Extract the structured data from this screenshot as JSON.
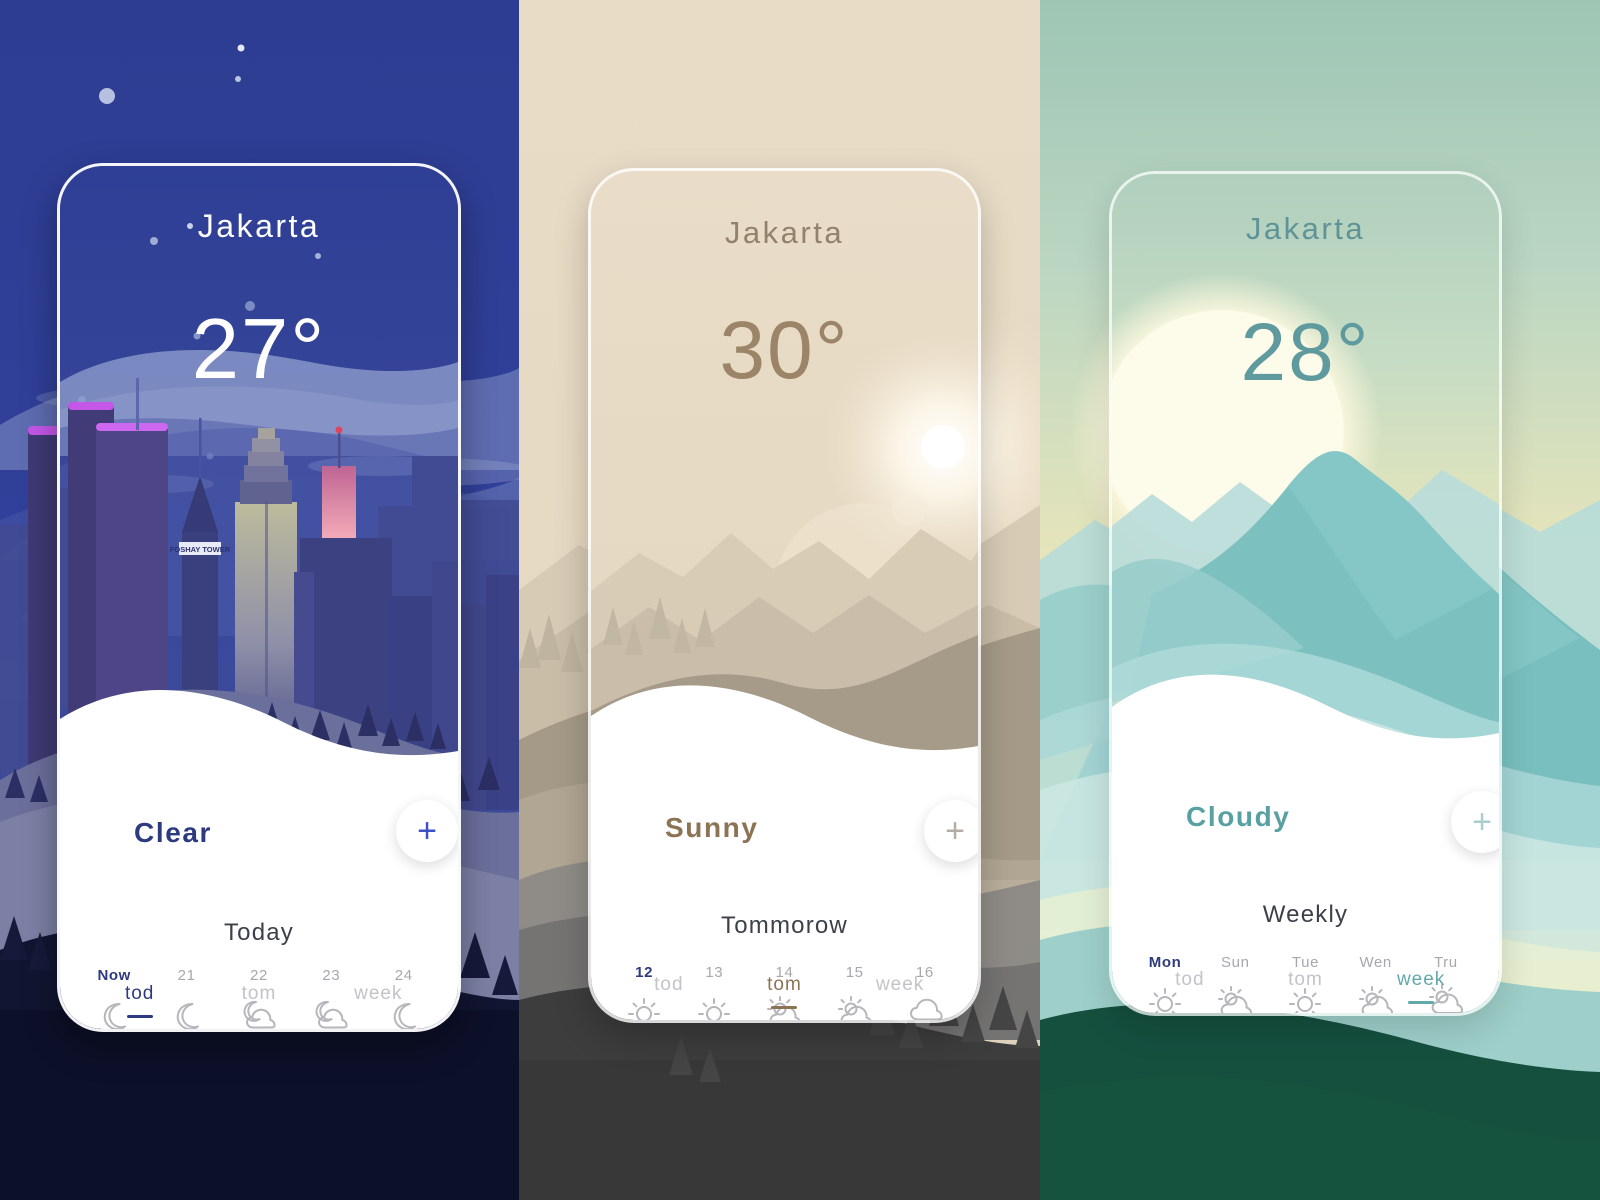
{
  "panels": [
    {
      "id": "night",
      "theme": "night-city",
      "accent": "#2e3a80",
      "city": "Jakarta",
      "temperature": "27°",
      "condition": "Clear",
      "add_label": "+",
      "day_title": "Today",
      "forecast": [
        {
          "label": "Now",
          "icon": "moon-icon",
          "active": true
        },
        {
          "label": "21",
          "icon": "moon-icon",
          "active": false
        },
        {
          "label": "22",
          "icon": "moon-cloud-icon",
          "active": false
        },
        {
          "label": "23",
          "icon": "moon-cloud-icon",
          "active": false
        },
        {
          "label": "24",
          "icon": "moon-icon",
          "active": false
        }
      ],
      "tabs": [
        {
          "label": "tod",
          "active": true
        },
        {
          "label": "tom",
          "active": false
        },
        {
          "label": "week",
          "active": false
        }
      ]
    },
    {
      "id": "sunrise",
      "theme": "sunrise-mountain",
      "accent": "#8b7354",
      "city": "Jakarta",
      "temperature": "30°",
      "condition": "Sunny",
      "add_label": "+",
      "day_title": "Tommorow",
      "forecast": [
        {
          "label": "12",
          "icon": "sun-icon",
          "active": true
        },
        {
          "label": "13",
          "icon": "sun-icon",
          "active": false
        },
        {
          "label": "14",
          "icon": "sun-cloud-icon",
          "active": false
        },
        {
          "label": "15",
          "icon": "sun-cloud-icon",
          "active": false
        },
        {
          "label": "16",
          "icon": "rain-cloud-icon",
          "active": false
        }
      ],
      "tabs": [
        {
          "label": "tod",
          "active": false
        },
        {
          "label": "tom",
          "active": true
        },
        {
          "label": "week",
          "active": false
        }
      ]
    },
    {
      "id": "day",
      "theme": "day-mountain",
      "accent": "#62a9ac",
      "city": "Jakarta",
      "temperature": "28°",
      "condition": "Cloudy",
      "add_label": "+",
      "day_title": "Weekly",
      "forecast": [
        {
          "label": "Mon",
          "icon": "sun-icon",
          "active": true
        },
        {
          "label": "Sun",
          "icon": "sun-cloud-icon",
          "active": false
        },
        {
          "label": "Tue",
          "icon": "sun-icon",
          "active": false
        },
        {
          "label": "Wen",
          "icon": "sun-cloud-icon",
          "active": false
        },
        {
          "label": "Tru",
          "icon": "sun-cloud-drizzle-icon",
          "active": false
        }
      ],
      "tabs": [
        {
          "label": "tod",
          "active": false
        },
        {
          "label": "tom",
          "active": false
        },
        {
          "label": "week",
          "active": true
        }
      ]
    }
  ],
  "scene_text": {
    "building_sign": "FOSHAY TOWER"
  },
  "colors": {
    "night_sky_top": "#2b3c8f",
    "night_sky_bottom": "#0f1230",
    "sunrise_sky": "#e6dac6",
    "sunrise_dark_ground": "#3c3c3c",
    "day_sky_top": "#b9d4c6",
    "day_sky_mid": "#f4e7b6",
    "day_ground": "#14503f",
    "card_white": "#ffffff"
  }
}
